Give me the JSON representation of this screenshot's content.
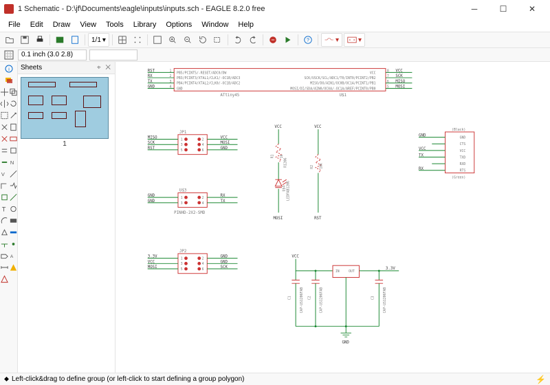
{
  "window": {
    "title": "1 Schematic - D:\\jf\\Documents\\eagle\\inputs\\inputs.sch - EAGLE 8.2.0 free"
  },
  "menu": [
    "File",
    "Edit",
    "Draw",
    "View",
    "Tools",
    "Library",
    "Options",
    "Window",
    "Help"
  ],
  "toolbar": {
    "zoom_combo": "1/1"
  },
  "secbar": {
    "coord": "0.1 inch (3.0 2.8)"
  },
  "sheets": {
    "title": "Sheets",
    "thumb_label": "1"
  },
  "schematic": {
    "main_IC": {
      "name": "ATtiny45",
      "ref": "U$1",
      "left_nets": [
        "RST",
        "RX",
        "TX",
        "GND"
      ],
      "left_nums": [
        "1",
        "2",
        "3",
        "4"
      ],
      "left_pins": [
        "PB5/PCINT5/-RESET/ADC0/DW",
        "PB3/PCINT3/XTAL1/CLK1/-OC1B/ADC3",
        "PB4/PCINT4/XTAL2/CLK0/-OC1B/ADC2",
        "GND"
      ],
      "right_nets": [
        "VCC",
        "SCK",
        "MISO",
        "MOSI"
      ],
      "right_nums": [
        "8",
        "7",
        "6",
        "5"
      ],
      "right_pins": [
        "VCC",
        "SCK/USCK/SCL/ADC1/T0/INT0/PCINT2/PB2",
        "MISO/DO/AIN1/OC0B/OC1A/PCINT1/PB1",
        "MOSI/DI/SDA/AIN0/OC0A/-OC1A/AREF/PCINT0/PB0"
      ]
    },
    "JP1": {
      "ref": "JP1",
      "left": [
        "MISO",
        "SCK",
        "RST"
      ],
      "right": [
        "VCC",
        "MOSI",
        "GND"
      ],
      "pins_l": [
        "1",
        "3",
        "5"
      ],
      "pins_r": [
        "2",
        "4",
        "6"
      ]
    },
    "U3": {
      "ref": "U$3",
      "name": "PINHD-2X2-SMD",
      "left": [
        "GND",
        "GND"
      ],
      "right": [
        "RX",
        "TX"
      ],
      "pins_l": [
        "1",
        "3"
      ],
      "pins_r": [
        "2",
        "4"
      ]
    },
    "JP2": {
      "ref": "JP2",
      "left": [
        "3.3V",
        "VCC",
        "MOSI"
      ],
      "right": [
        "GND",
        "GND",
        "SCK"
      ],
      "pins_l": [
        "1",
        "3",
        "5"
      ],
      "pins_r": [
        "2",
        "4",
        "6"
      ]
    },
    "R1": {
      "ref": "R1",
      "val": "1k",
      "name": "R1206"
    },
    "LED": {
      "ref": "U$4",
      "name": "LEDFAB1206",
      "net_top": "VCC",
      "net_bot": "MOSI"
    },
    "R2": {
      "ref": "R2",
      "val": "10k",
      "net_top": "VCC",
      "net_bot": "RST"
    },
    "FTDI": {
      "color_top": "(Black)",
      "color_bot": "(Green)",
      "pins": [
        "GND",
        "CTS",
        "VCC",
        "TXD",
        "RXD",
        "RTS"
      ],
      "left_nets": [
        "GND",
        "",
        "VCC",
        "TX",
        "",
        "RX"
      ]
    },
    "reg": {
      "in": "IN",
      "out": "OUT",
      "vcc": "VCC",
      "v33": "3.3V",
      "c1": {
        "ref": "C1",
        "name": "CAP-US1206FAB"
      },
      "c2": {
        "ref": "C2",
        "name": "CAP-US1206FAB"
      },
      "c3": {
        "ref": "C3",
        "name": "CAP-US1206FAB"
      },
      "gnd": "GND"
    }
  },
  "status": {
    "text": "Left-click&drag to define group (or left-click to start defining a group polygon)"
  }
}
